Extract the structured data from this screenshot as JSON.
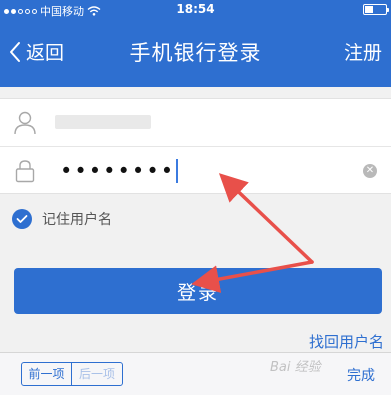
{
  "status_bar": {
    "carrier": "中国移动",
    "time": "18:54",
    "battery_level": 0.4,
    "icons": [
      "signal-dots-icon",
      "wifi-icon",
      "battery-icon"
    ]
  },
  "nav": {
    "back_label": "返回",
    "title": "手机银行登录",
    "register_label": "注册"
  },
  "form": {
    "username_icon": "user-icon",
    "password_icon": "lock-icon",
    "password_mask": "••••••••",
    "clear_icon": "clear-icon"
  },
  "remember": {
    "label": "记住用户名",
    "checked": true
  },
  "login_button": {
    "label": "登录"
  },
  "forgot_link": {
    "label": "找回用户名"
  },
  "keyboard_toolbar": {
    "prev_label": "前一项",
    "next_label": "后一项",
    "done_label": "完成"
  },
  "colors": {
    "primary": "#2e6fd0",
    "annotation_arrow": "#e8504a",
    "page_background": "#f1f1f1"
  }
}
